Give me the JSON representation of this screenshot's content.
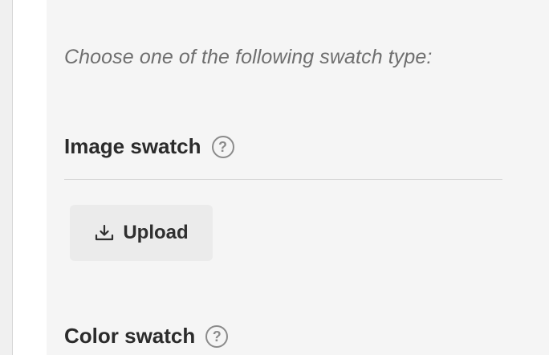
{
  "swatch_section": {
    "intro_text": "Choose one of the following swatch type:",
    "image_swatch": {
      "label": "Image swatch",
      "help_glyph": "?",
      "upload_label": "Upload",
      "upload_icon": "download-icon"
    },
    "color_swatch": {
      "label": "Color swatch",
      "help_glyph": "?"
    }
  },
  "colors": {
    "panel_background": "#f5f5f5",
    "heading_text": "#2b2b2b",
    "muted_text": "#6f6f6f",
    "button_background": "#ebebeb"
  }
}
